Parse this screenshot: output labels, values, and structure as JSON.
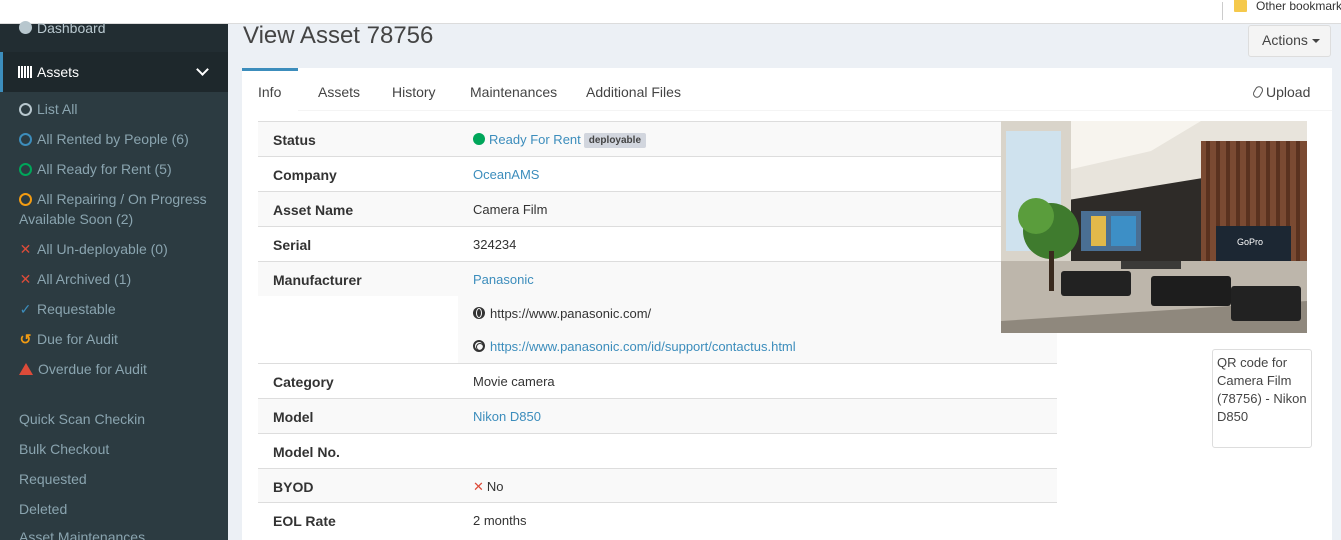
{
  "browser": {
    "bookmark_folder": "Other bookmarks"
  },
  "sidebar": {
    "dashboard": "Dashboard",
    "assets": "Assets",
    "filters": [
      {
        "label": "List All",
        "icon": "circle-icon"
      },
      {
        "label": "All Rented by People (6)",
        "icon": "circle-blue-icon"
      },
      {
        "label": "All Ready for Rent (5)",
        "icon": "circle-green-icon"
      },
      {
        "label": "All Repairing / On Progress",
        "label2": "Available Soon (2)",
        "icon": "circle-orange-icon"
      },
      {
        "label": "All Un-deployable (0)",
        "icon": "x-icon"
      },
      {
        "label": "All Archived (1)",
        "icon": "x-icon"
      },
      {
        "label": "Requestable",
        "icon": "check-icon"
      },
      {
        "label": "Due for Audit",
        "icon": "history-icon"
      },
      {
        "label": "Overdue for Audit",
        "icon": "warning-icon"
      }
    ],
    "links": [
      "Quick Scan Checkin",
      "Bulk Checkout",
      "Requested",
      "Deleted",
      "Asset Maintenances"
    ]
  },
  "page": {
    "title": "View Asset 78756",
    "actions_label": "Actions"
  },
  "tabs": [
    "Info",
    "Assets",
    "History",
    "Maintenances",
    "Additional Files"
  ],
  "upload_label": "Upload",
  "details": {
    "status_key": "Status",
    "status_value": "Ready For Rent",
    "status_badge": "deployable",
    "company_key": "Company",
    "company_value": "OceanAMS",
    "asset_name_key": "Asset Name",
    "asset_name_value": "Camera Film",
    "serial_key": "Serial",
    "serial_value": "324234",
    "manufacturer_key": "Manufacturer",
    "manufacturer_value": "Panasonic",
    "manufacturer_url": "https://www.panasonic.com/",
    "manufacturer_support_url": "https://www.panasonic.com/id/support/contactus.html",
    "category_key": "Category",
    "category_value": "Movie camera",
    "model_key": "Model",
    "model_value": "Nikon D850",
    "model_no_key": "Model No.",
    "model_no_value": "",
    "byod_key": "BYOD",
    "byod_value": "No",
    "eol_key": "EOL Rate",
    "eol_value": "2 months"
  },
  "qr_alt": "QR code for Camera Film (78756) - Nikon D850",
  "photo_sign": "GoPro"
}
